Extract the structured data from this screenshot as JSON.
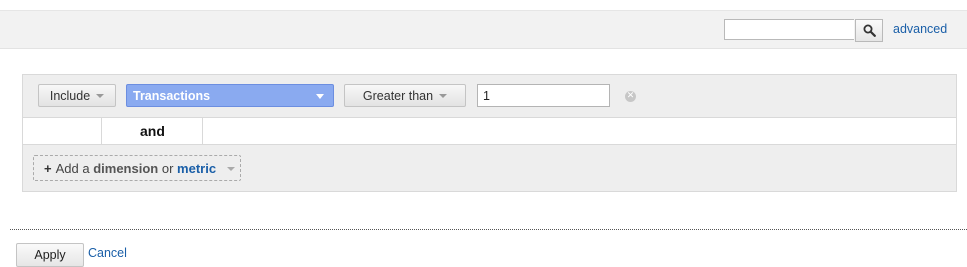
{
  "toolbar": {
    "search": {
      "value": "",
      "placeholder": ""
    },
    "search_icon": "magnifier-icon",
    "advanced_label": "advanced"
  },
  "filter": {
    "include_label": "Include",
    "dimension_label": "Transactions",
    "condition_label": "Greater than",
    "value": "1",
    "remove_icon": "close-circle-icon",
    "dimension_highlight_color": "#8aaaf0"
  },
  "joiner": {
    "label": "and"
  },
  "add_row": {
    "plus": "+",
    "add_a": "Add a",
    "dimension": "dimension",
    "or": "or",
    "metric": "metric"
  },
  "actions": {
    "apply_label": "Apply",
    "cancel_label": "Cancel",
    "link_color": "#1a5fa8"
  }
}
